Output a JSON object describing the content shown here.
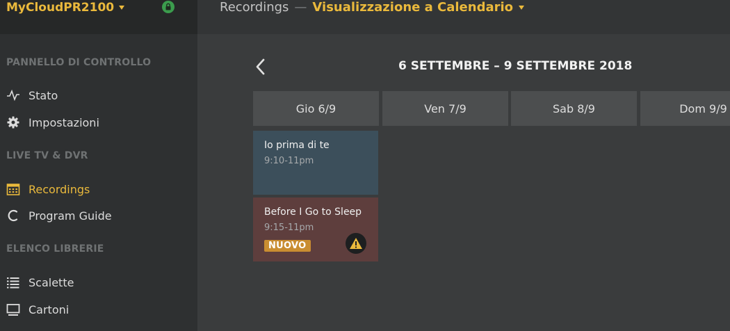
{
  "sidebar": {
    "server_name": "MyCloudPR2100",
    "sections": [
      {
        "title": "PANNELLO DI CONTROLLO",
        "items": [
          {
            "label": "Stato",
            "icon": "activity-icon"
          },
          {
            "label": "Impostazioni",
            "icon": "gear-icon"
          }
        ]
      },
      {
        "title": "LIVE TV & DVR",
        "items": [
          {
            "label": "Recordings",
            "icon": "calendar-icon",
            "active": true
          },
          {
            "label": "Program Guide",
            "icon": "spinner-icon"
          }
        ]
      },
      {
        "title": "ELENCO LIBRERIE",
        "items": [
          {
            "label": "Scalette",
            "icon": "list-icon"
          },
          {
            "label": "Cartoni",
            "icon": "monitor-icon"
          }
        ]
      }
    ]
  },
  "header": {
    "parent": "Recordings",
    "separator": "—",
    "view": "Visualizzazione a Calendario"
  },
  "calendar": {
    "range": "6 SETTEMBRE – 9 SETTEMBRE 2018",
    "days": [
      "Gio 6/9",
      "Ven 7/9",
      "Sab 8/9",
      "Dom 9/9"
    ],
    "events": [
      {
        "title": "Io prima di te",
        "time": "9:10-11pm",
        "color": "#3c4f5b"
      },
      {
        "title": "Before I Go to Sleep",
        "time": "9:15-11pm",
        "badge": "NUOVO",
        "warning": true,
        "color": "#5e3e3d"
      }
    ]
  },
  "colors": {
    "accent": "#eab93c",
    "badge": "#c98d31"
  }
}
